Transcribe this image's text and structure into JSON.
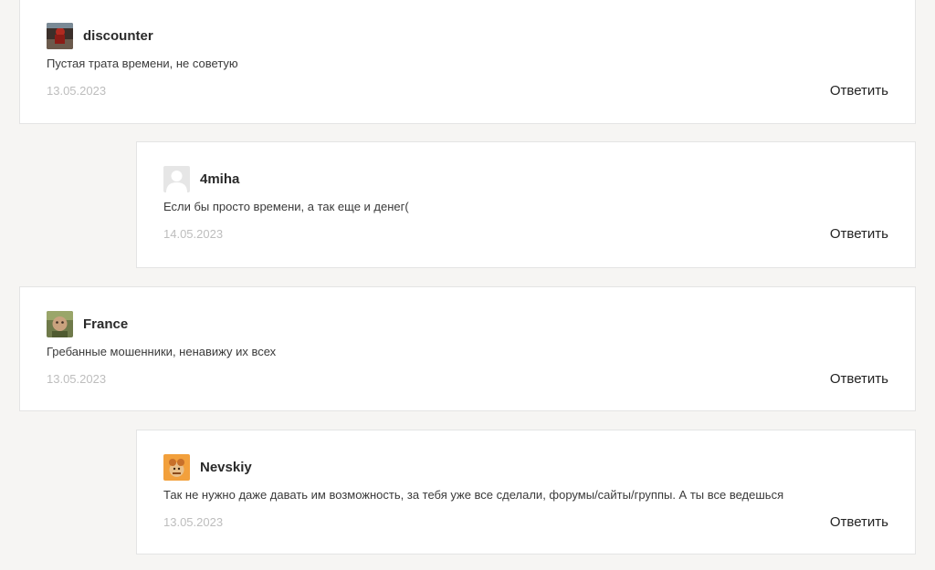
{
  "comments": [
    {
      "author": "discounter",
      "avatar_icon": "user-photo-icon",
      "text": "Пустая трата времени, не советую",
      "date": "13.05.2023",
      "reply_label": "Ответить"
    },
    {
      "author": "4miha",
      "avatar_icon": "default-user-icon",
      "text": "Если бы просто времени, а так еще и денег(",
      "date": "14.05.2023",
      "reply_label": "Ответить"
    },
    {
      "author": "France",
      "avatar_icon": "user-photo-icon",
      "text": "Гребанные мошенники, ненавижу их всех",
      "date": "13.05.2023",
      "reply_label": "Ответить"
    },
    {
      "author": "Nevskiy",
      "avatar_icon": "cartoon-avatar-icon",
      "text": "Так не нужно даже давать им возможность, за тебя уже все сделали, форумы/сайты/группы. А ты все ведешься",
      "date": "13.05.2023",
      "reply_label": "Ответить"
    }
  ],
  "colors": {
    "page_background": "#f6f5f3",
    "card_background": "#ffffff",
    "date_text": "#bdbdbd"
  }
}
